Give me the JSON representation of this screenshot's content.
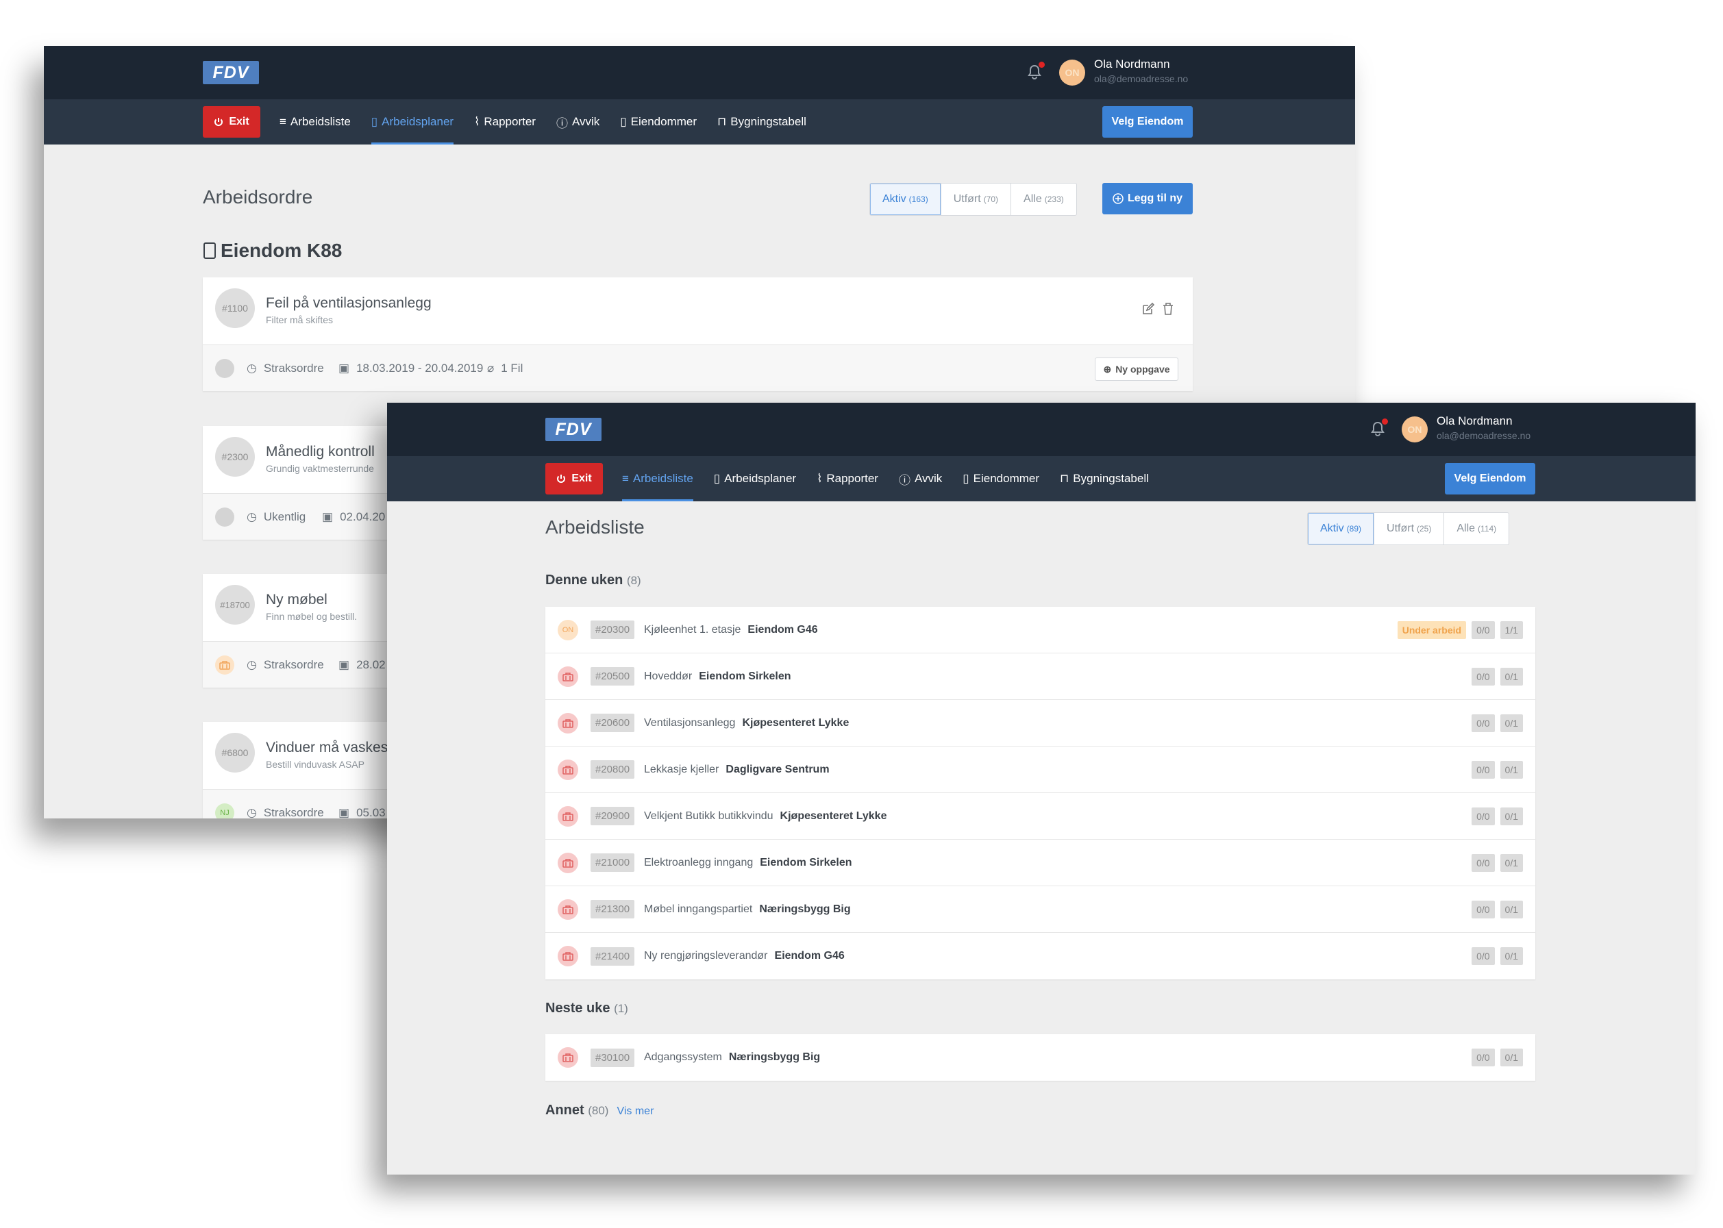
{
  "back_window": {
    "logo": "FDV",
    "user": {
      "initials": "ON",
      "name": "Ola Nordmann",
      "email": "ola@demoadresse.no"
    },
    "exit_label": "Exit",
    "nav": [
      "Arbeidsliste",
      "Arbeidsplaner",
      "Rapporter",
      "Avvik",
      "Eiendommer",
      "Bygningstabell"
    ],
    "active_nav": "Arbeidsplaner",
    "velg_label": "Velg Eiendom",
    "page_title": "Arbeidsordre",
    "filters": [
      {
        "label": "Aktiv",
        "count": "(163)"
      },
      {
        "label": "Utført",
        "count": "(70)"
      },
      {
        "label": "Alle",
        "count": "(233)"
      }
    ],
    "add_label": "Legg til ny",
    "property_title": "Eiendom K88",
    "cards": [
      {
        "num": "#1100",
        "title": "Feil på ventilasjonsanlegg",
        "sub": "Filter må skiftes",
        "freq": "Straksordre",
        "dates": "18.03.2019 - 20.04.2019",
        "files": "1 Fil",
        "new_task": "Ny oppgave"
      },
      {
        "num": "#2300",
        "title": "Månedlig kontroll",
        "sub": "Grundig vaktmesterrunde",
        "freq": "Ukentlig",
        "dates": "02.04.20"
      },
      {
        "num": "#18700",
        "title": "Ny møbel",
        "sub": "Finn møbel og bestill.",
        "freq": "Straksordre",
        "dates": "28.02"
      },
      {
        "num": "#6800",
        "title": "Vinduer må vaskes",
        "sub": "Bestill vinduvask ASAP",
        "freq": "Straksordre",
        "dates": "05.03",
        "avatar": "NJ"
      }
    ]
  },
  "front_window": {
    "logo": "FDV",
    "user": {
      "initials": "ON",
      "name": "Ola Nordmann",
      "email": "ola@demoadresse.no"
    },
    "exit_label": "Exit",
    "nav": [
      "Arbeidsliste",
      "Arbeidsplaner",
      "Rapporter",
      "Avvik",
      "Eiendommer",
      "Bygningstabell"
    ],
    "active_nav": "Arbeidsliste",
    "velg_label": "Velg Eiendom",
    "page_title": "Arbeidsliste",
    "filters": [
      {
        "label": "Aktiv",
        "count": "(89)"
      },
      {
        "label": "Utført",
        "count": "(25)"
      },
      {
        "label": "Alle",
        "count": "(114)"
      }
    ],
    "sections": {
      "this_week": {
        "title": "Denne uken",
        "count": "(8)"
      },
      "next_week": {
        "title": "Neste uke",
        "count": "(1)"
      },
      "other": {
        "title": "Annet",
        "count": "(80)",
        "more": "Vis mer"
      }
    },
    "this_week_rows": [
      {
        "id": "#20300",
        "task": "Kjøleenhet 1. etasje",
        "property": "Eiendom G46",
        "status": "Under arbeid",
        "b1": "0/0",
        "b2": "1/1",
        "avatar": "ON"
      },
      {
        "id": "#20500",
        "task": "Hoveddør",
        "property": "Eiendom Sirkelen",
        "status": "",
        "b1": "0/0",
        "b2": "0/1"
      },
      {
        "id": "#20600",
        "task": "Ventilasjonsanlegg",
        "property": "Kjøpesenteret Lykke",
        "status": "",
        "b1": "0/0",
        "b2": "0/1"
      },
      {
        "id": "#20800",
        "task": "Lekkasje kjeller",
        "property": "Dagligvare Sentrum",
        "status": "",
        "b1": "0/0",
        "b2": "0/1"
      },
      {
        "id": "#20900",
        "task": "Velkjent Butikk butikkvindu",
        "property": "Kjøpesenteret Lykke",
        "status": "",
        "b1": "0/0",
        "b2": "0/1"
      },
      {
        "id": "#21000",
        "task": "Elektroanlegg inngang",
        "property": "Eiendom Sirkelen",
        "status": "",
        "b1": "0/0",
        "b2": "0/1"
      },
      {
        "id": "#21300",
        "task": "Møbel inngangspartiet",
        "property": "Næringsbygg Big",
        "status": "",
        "b1": "0/0",
        "b2": "0/1"
      },
      {
        "id": "#21400",
        "task": "Ny rengjøringsleverandør",
        "property": "Eiendom G46",
        "status": "",
        "b1": "0/0",
        "b2": "0/1"
      }
    ],
    "next_week_rows": [
      {
        "id": "#30100",
        "task": "Adgangssystem",
        "property": "Næringsbygg Big",
        "status": "",
        "b1": "0/0",
        "b2": "0/1"
      }
    ]
  },
  "colors": {
    "topbar": "#1c2633",
    "navbar": "#2b3746",
    "accent": "#3b82d6",
    "danger": "#d42828",
    "status": "#f0a34c"
  }
}
